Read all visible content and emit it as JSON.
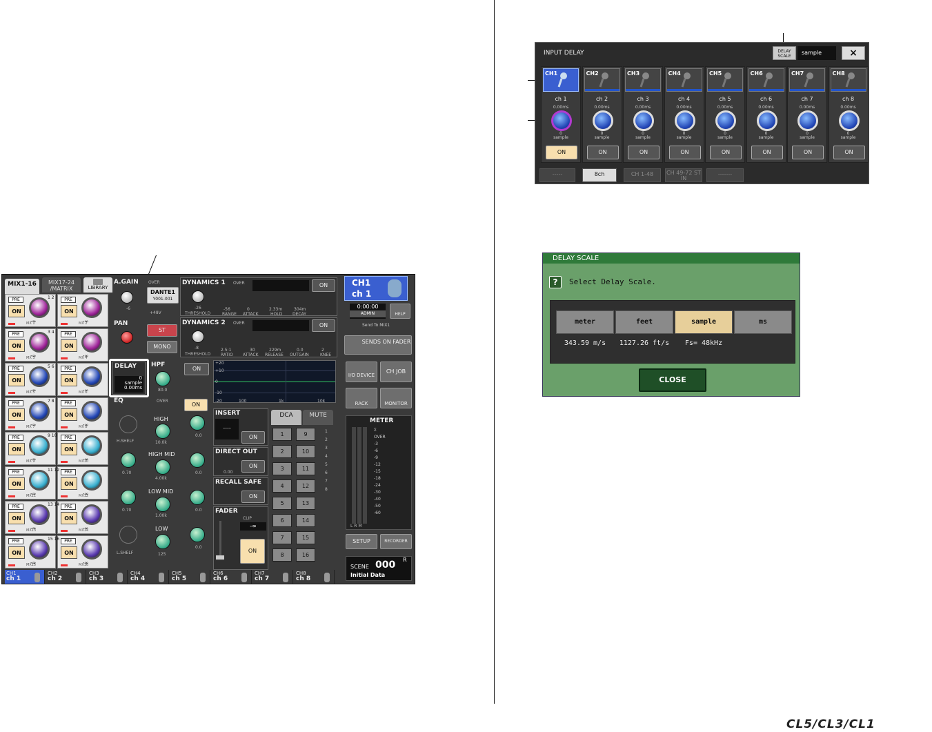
{
  "brand": "CL5/CL3/CL1",
  "mixer": {
    "tabs": {
      "mix1_16": "MIX1-16",
      "mix17_24": "MIX17-24 /MATRIX",
      "library": "LIBRARY"
    },
    "mix_cells": [
      {
        "num": "1 2",
        "label": "MX 1",
        "label2": "MX 2",
        "pre": "PRE",
        "on": "ON",
        "val": "-∞",
        "color": "#a0259b"
      },
      {
        "num": "3 4",
        "label": "MX 3",
        "label2": "MX 4",
        "pre": "PRE",
        "on": "ON",
        "val": "-∞",
        "color": "#a0259b"
      },
      {
        "num": "5 6",
        "label": "MX 5",
        "label2": "MX 6",
        "pre": "PRE",
        "on": "ON",
        "val": "-∞",
        "color": "#2347b6"
      },
      {
        "num": "7 8",
        "label": "MX 7",
        "label2": "MX 8",
        "pre": "PRE",
        "on": "ON",
        "val": "-∞",
        "color": "#2347b6"
      },
      {
        "num": "9 10",
        "label": "MX 9",
        "label2": "MX10",
        "pre": "PRE",
        "on": "ON",
        "val": "-∞",
        "color": "#3ab0d0"
      },
      {
        "num": "11 12",
        "label": "MX11",
        "label2": "MX12",
        "pre": "PRE",
        "on": "ON",
        "val": "-∞",
        "color": "#3ab0d0"
      },
      {
        "num": "13 14",
        "label": "MX13",
        "label2": "MX14",
        "pre": "PRE",
        "on": "ON",
        "val": "-∞",
        "color": "#5a3ab0"
      },
      {
        "num": "15 16",
        "label": "MX15",
        "label2": "MX16",
        "pre": "PRE",
        "on": "ON",
        "val": "-∞",
        "color": "#5a3ab0"
      }
    ],
    "again": {
      "title": "A.GAIN",
      "value": "-6",
      "over": "OVER",
      "patch": "DANTE1",
      "patch2": "Y001-001",
      "phantom": "+48V"
    },
    "pan": {
      "title": "PAN",
      "st": "ST",
      "mono": "MONO"
    },
    "dyn1": {
      "title": "DYNAMICS 1",
      "over": "OVER",
      "on": "ON",
      "threshold": "-26",
      "threshold_lbl": "THRESHOLD",
      "range": "-56",
      "attack": "0",
      "hold": "2.33m",
      "decay": "304m",
      "range_lbl": "RANGE",
      "attack_lbl": "ATTACK",
      "hold_lbl": "HOLD",
      "decay_lbl": "DECAY"
    },
    "dyn2": {
      "title": "DYNAMICS 2",
      "over": "OVER",
      "on": "ON",
      "threshold": "-8",
      "threshold_lbl": "THRESHOLD",
      "ratio": "2.5:1",
      "attack": "30",
      "release": "229m",
      "outgain": "0.0",
      "knee": "2",
      "ratio_lbl": "RATIO",
      "attack_lbl": "ATTACK",
      "release_lbl": "RELEASE",
      "outgain_lbl": "OUTGAIN",
      "knee_lbl": "KNEE"
    },
    "delay": {
      "title": "DELAY",
      "value": "0",
      "unit": "sample",
      "ms": "0.00ms"
    },
    "hpf": {
      "title": "HPF",
      "value": "80.0",
      "on": "ON"
    },
    "eq_graph": {
      "y_labels": [
        "+20",
        "+10",
        "0",
        "-10",
        "-20"
      ],
      "x_labels": [
        "100",
        "1k",
        "10k"
      ]
    },
    "eq": {
      "title": "EQ",
      "over": "OVER",
      "on": "ON",
      "high": "HIGH",
      "high_freq": "10.0k",
      "high_gain": "0.0",
      "high_shelf": "H.SHELF",
      "high_mid": "HIGH MID",
      "hm_q": "0.70",
      "hm_freq": "4.00k",
      "hm_gain": "0.0",
      "low_mid": "LOW MID",
      "lm_q": "0.70",
      "lm_freq": "1.00k",
      "lm_gain": "0.0",
      "low": "LOW",
      "low_freq": "125",
      "low_gain": "0.0",
      "low_shelf": "L.SHELF",
      "freq_lbl": "FREQUENCY",
      "gain_lbl": "GAIN",
      "q_lbl": "Q"
    },
    "insert": {
      "title": "INSERT",
      "value": "----",
      "on": "ON"
    },
    "direct_out": {
      "title": "DIRECT OUT",
      "value": "0.00",
      "on": "ON"
    },
    "recall_safe": {
      "title": "RECALL SAFE",
      "on": "ON"
    },
    "fader": {
      "title": "FADER",
      "clip": "CLIP",
      "value": "-∞",
      "on": "ON",
      "scale": [
        "10",
        "0",
        "10",
        "30",
        "∞"
      ]
    },
    "dca": {
      "tab": "DCA",
      "mute_tab": "MUTE",
      "buttons": [
        "1",
        "9",
        "2",
        "10",
        "3",
        "11",
        "4",
        "12",
        "5",
        "13",
        "6",
        "14",
        "7",
        "15",
        "8",
        "16"
      ],
      "mute_nums": [
        "1",
        "2",
        "3",
        "4",
        "5",
        "6",
        "7",
        "8"
      ]
    },
    "right": {
      "ch": "CH1",
      "ch_name": "ch 1",
      "time": "0:00:00",
      "user": "ADMIN",
      "help": "HELP",
      "send_to": "Send To MIX1",
      "sends_on_fader": "SENDS ON FADER",
      "io_device": "I/O DEVICE",
      "ch_job": "CH JOB",
      "rack": "RACK",
      "monitor": "MONITOR",
      "meter": "METER",
      "meter_scale": [
        "Σ",
        "OVER",
        "-3",
        "-6",
        "-9",
        "-12",
        "-15",
        "-18",
        "-24",
        "-30",
        "-40",
        "-50",
        "-60"
      ],
      "meter_lrm": "L R M",
      "setup": "SETUP",
      "recorder": "RECORDER",
      "scene_lbl": "SCENE",
      "scene_num": "000",
      "scene_r": "R",
      "scene_name": "Initial Data"
    },
    "channel_strip": [
      {
        "ch": "CH1",
        "name": "ch 1"
      },
      {
        "ch": "CH2",
        "name": "ch 2"
      },
      {
        "ch": "CH3",
        "name": "ch 3"
      },
      {
        "ch": "CH4",
        "name": "ch 4"
      },
      {
        "ch": "CH5",
        "name": "ch 5"
      },
      {
        "ch": "CH6",
        "name": "ch 6"
      },
      {
        "ch": "CH7",
        "name": "ch 7"
      },
      {
        "ch": "CH8",
        "name": "ch 8"
      }
    ]
  },
  "input_delay": {
    "title": "INPUT DELAY",
    "delay_scale_label": "DELAY SCALE",
    "delay_scale_value": "sample",
    "close_icon": "×",
    "channels": [
      {
        "ch": "CH1",
        "name": "ch 1",
        "ms": "0.00ms",
        "value": "0",
        "unit": "sample",
        "on": "ON"
      },
      {
        "ch": "CH2",
        "name": "ch 2",
        "ms": "0.00ms",
        "value": "0",
        "unit": "sample",
        "on": "ON"
      },
      {
        "ch": "CH3",
        "name": "ch 3",
        "ms": "0.00ms",
        "value": "0",
        "unit": "sample",
        "on": "ON"
      },
      {
        "ch": "CH4",
        "name": "ch 4",
        "ms": "0.00ms",
        "value": "0",
        "unit": "sample",
        "on": "ON"
      },
      {
        "ch": "CH5",
        "name": "ch 5",
        "ms": "0.00ms",
        "value": "0",
        "unit": "sample",
        "on": "ON"
      },
      {
        "ch": "CH6",
        "name": "ch 6",
        "ms": "0.00ms",
        "value": "0",
        "unit": "sample",
        "on": "ON"
      },
      {
        "ch": "CH7",
        "name": "ch 7",
        "ms": "0.00ms",
        "value": "0",
        "unit": "sample",
        "on": "ON"
      },
      {
        "ch": "CH8",
        "name": "ch 8",
        "ms": "0.00ms",
        "value": "0",
        "unit": "sample",
        "on": "ON"
      }
    ],
    "tabs": [
      "-----",
      "8ch",
      "CH 1-48",
      "CH 49-72 ST IN",
      "-------"
    ]
  },
  "delay_scale": {
    "title": "DELAY SCALE",
    "question_icon": "?",
    "message": "Select Delay Scale.",
    "options": [
      {
        "label": "meter",
        "value": "343.59 m/s"
      },
      {
        "label": "feet",
        "value": "1127.26 ft/s"
      },
      {
        "label": "sample",
        "value": "Fs= 48kHz"
      },
      {
        "label": "ms",
        "value": ""
      }
    ],
    "selected": "sample",
    "close": "CLOSE"
  }
}
